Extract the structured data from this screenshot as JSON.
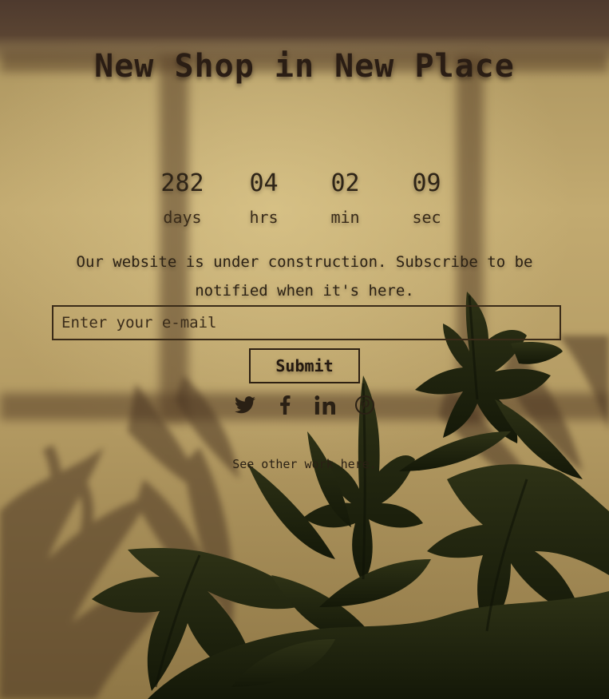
{
  "page": {
    "title": "New Shop in New Place"
  },
  "countdown": [
    {
      "value": "282",
      "unit": "days"
    },
    {
      "value": "04",
      "unit": "hrs"
    },
    {
      "value": "02",
      "unit": "min"
    },
    {
      "value": "09",
      "unit": "sec"
    }
  ],
  "message": "Our website is under construction. Subscribe to be notified when it's here.",
  "subscribe": {
    "email_placeholder": "Enter your e-mail",
    "submit_label": "Submit"
  },
  "socials": [
    {
      "icon": "twitter-icon"
    },
    {
      "icon": "facebook-icon"
    },
    {
      "icon": "linkedin-icon"
    },
    {
      "icon": "pinterest-icon"
    }
  ],
  "footer": {
    "other_work_link": "See other work here."
  },
  "colors": {
    "text": "#2a1d14",
    "background": "#b8a068",
    "shade": "#4e3a2e",
    "plant": "#1f2410"
  }
}
